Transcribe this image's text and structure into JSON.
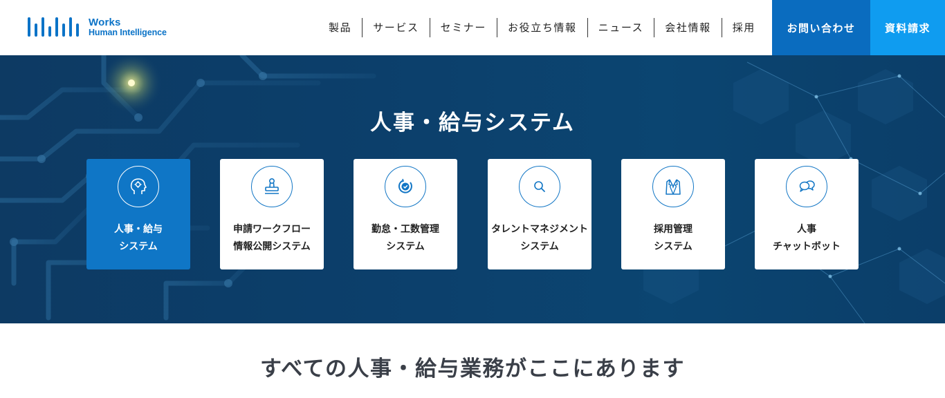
{
  "brand": {
    "name_line1": "Works",
    "name_line2": "Human Intelligence",
    "color": "#0b73c7"
  },
  "nav": {
    "items": [
      "製品",
      "サービス",
      "セミナー",
      "お役立ち情報",
      "ニュース",
      "会社情報",
      "採用"
    ],
    "contact_label": "お問い合わせ",
    "docs_label": "資料請求"
  },
  "hero": {
    "title": "人事・給与システム",
    "cards": [
      {
        "line1": "人事・給与",
        "line2": "システム",
        "icon": "head-gear-icon",
        "active": true
      },
      {
        "line1": "申請ワークフロー",
        "line2": "情報公開システム",
        "icon": "stamp-icon",
        "active": false
      },
      {
        "line1": "勤怠・工数管理",
        "line2": "システム",
        "icon": "clock-check-icon",
        "active": false
      },
      {
        "line1": "タレントマネジメント",
        "line2": "システム",
        "icon": "magnifier-icon",
        "active": false
      },
      {
        "line1": "採用管理",
        "line2": "システム",
        "icon": "suit-icon",
        "active": false
      },
      {
        "line1": "人事",
        "line2": "チャットボット",
        "icon": "chat-bubbles-icon",
        "active": false
      }
    ]
  },
  "section": {
    "title": "すべての人事・給与業務がここにあります"
  },
  "colors": {
    "accent": "#0a6cbf",
    "accent_light": "#0f9cf0",
    "hero_bg": "#0c3f6b"
  }
}
